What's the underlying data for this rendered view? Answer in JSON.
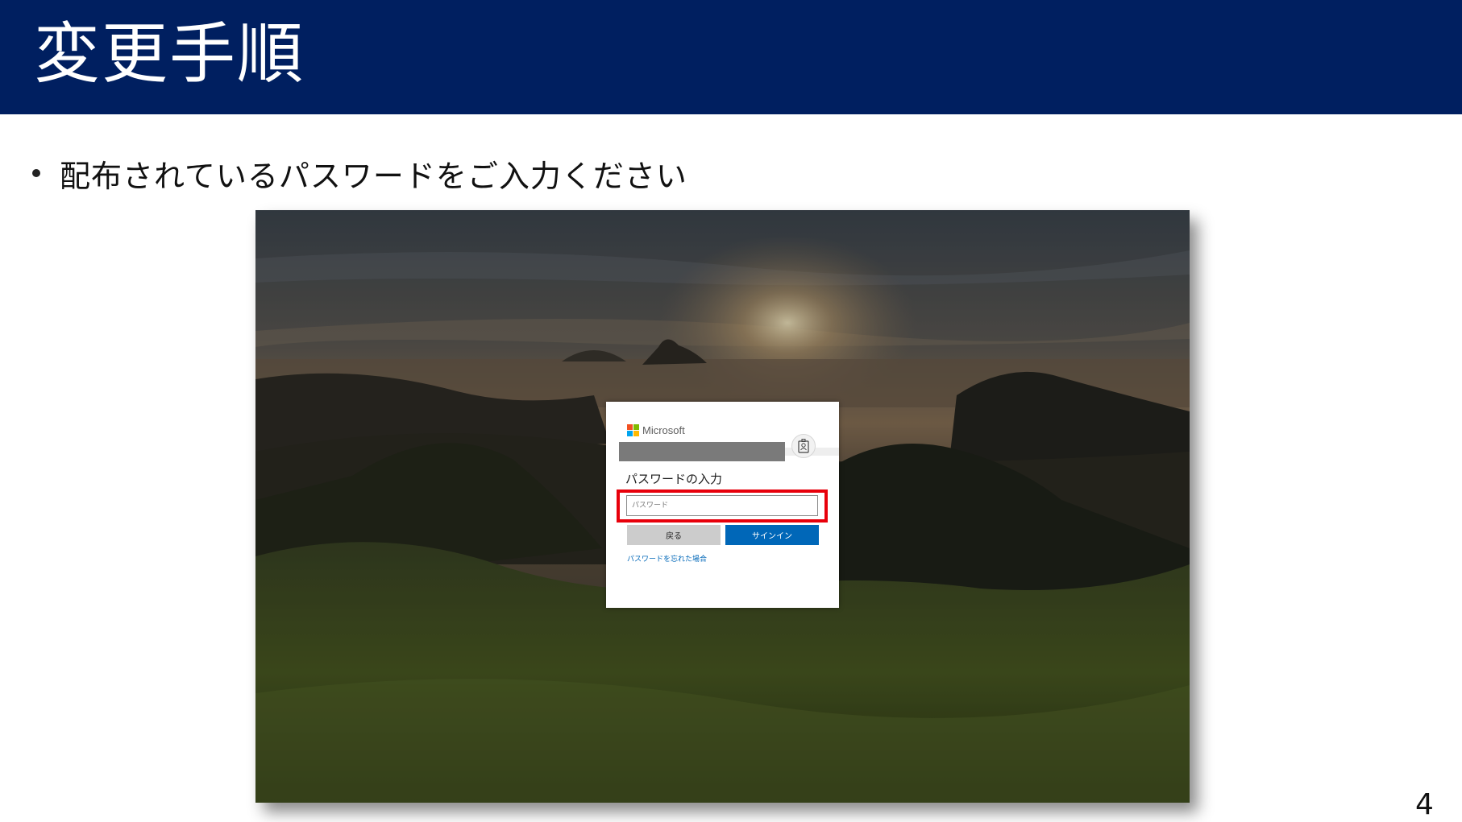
{
  "slide": {
    "title": "変更手順",
    "bullet": "配布されているパスワードをご入力ください",
    "page_number": "4"
  },
  "login_dialog": {
    "brand": "Microsoft",
    "heading": "パスワードの入力",
    "password_placeholder": "パスワード",
    "back_label": "戻る",
    "signin_label": "サインイン",
    "forgot_link": "パスワードを忘れた場合"
  },
  "colors": {
    "header_bg": "#001f60",
    "highlight": "#e8000b",
    "primary_button": "#0067b8",
    "secondary_button": "#cccccc"
  },
  "icons": {
    "bullet": "bullet-dot",
    "account": "badge-icon",
    "logo": "microsoft-logo"
  }
}
